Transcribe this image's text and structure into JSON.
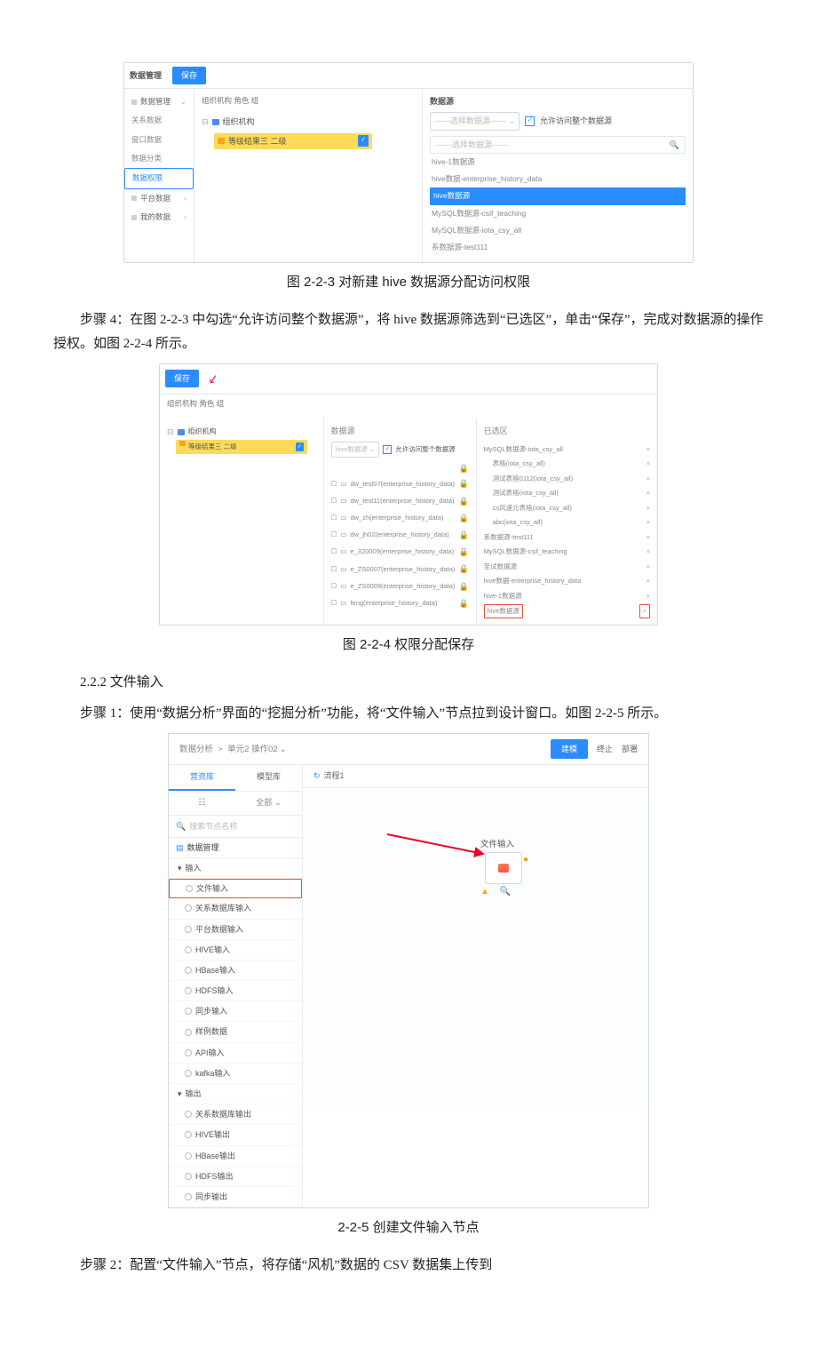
{
  "fig223": {
    "hdr_title": "数据管理",
    "hdr_save": "保存",
    "sidebar": {
      "items": [
        "数据管理",
        "关系数据",
        "窗口数据",
        "数据分类",
        "数据权限",
        "平台数据",
        "我的数据"
      ],
      "sel_index": 4
    },
    "crumb": "组织机构    角色    组",
    "tree_root": "组织机构",
    "tree_child": "等级结果三 二级",
    "right": {
      "title": "数据源",
      "picker": "------选择数据源------",
      "allow": "允许访问整个数据源",
      "search": "------选择数据源------",
      "items": [
        "hive-1数据源",
        "hive数据-enterprise_history_data",
        "hive数据源",
        "MySQL数据源-csif_teaching",
        "MySQL数据源-iota_csy_all",
        "系数据源-test111"
      ],
      "hl_index": 2
    },
    "caption": "图 2-2-3  对新建 hive 数据源分配访问权限"
  },
  "p1": "步骤 4：在图 2-2-3 中勾选“允许访问整个数据源”，将 hive 数据源筛选到“已选区”，单击“保存”，完成对数据源的操作授权。如图 2-2-4 所示。",
  "fig224": {
    "save": "保存",
    "crumb": "组织机构    角色    组",
    "tree_root": "组织机构",
    "tree_child": "等级结果三 二级",
    "mid": {
      "title": "数据源",
      "picker": "hive数据源",
      "allow": "允许访问整个数据源",
      "items": [
        "dw_test07(enterprise_history_data)",
        "dw_test11(enterprise_history_data)",
        "dw_zh(enterprise_history_data)",
        "dw_jh02(enterprise_history_data)",
        "e_320009(enterprise_history_data)",
        "e_ZS0007(enterprise_history_data)",
        "e_ZS0009(enterprise_history_data)",
        "feng(enterprise_history_data)"
      ]
    },
    "right": {
      "title": "已选区",
      "items": [
        "MySQL数据源-iota_csy_all",
        "表格(iota_csy_all)",
        "测试表格0112(iota_csy_all)",
        "测试表格(iota_csy_all)",
        "cs风速元表格(iota_csy_all)",
        "abc(iota_csy_all)",
        "系数据源-test111",
        "MySQL数据源-csif_teaching",
        "至试数据源",
        "hive数据-enterprise_history_data",
        "hive-1数据源",
        "hive数据源"
      ],
      "boxed_index": 11
    },
    "caption": "图 2-2-4  权限分配保存"
  },
  "subhead": "2.2.2 文件输入",
  "p2": "步骤 1：使用“数据分析”界面的“挖掘分析”功能，将“文件输入”节点拉到设计窗口。如图 2-2-5 所示。",
  "fig225": {
    "breadcrumb": {
      "a": "数据分析",
      "sep": ">",
      "b": "单元2 操作02"
    },
    "actions": {
      "run": "建模",
      "clear": "终止",
      "deploy": "部署"
    },
    "tabs": {
      "lib": "营资库",
      "model": "模型库"
    },
    "filter": "全部",
    "search": "搜索节点名称",
    "cat1": "数据管理",
    "group_in": "输入",
    "inputs": [
      "文件输入",
      "关系数据库输入",
      "平台数据输入",
      "HIVE输入",
      "HBase输入",
      "HDFS输入",
      "同步输入",
      "样例数据",
      "API输入",
      "kafka输入"
    ],
    "boxed_index": 0,
    "group_out": "输出",
    "outputs": [
      "关系数据库输出",
      "HIVE输出",
      "HBase输出",
      "HDFS输出",
      "同步输出"
    ],
    "flowtab": "流程1",
    "nodelabel": "文件输入",
    "caption": "2-2-5 创建文件输入节点"
  },
  "p3": "步骤 2：配置“文件输入”节点，将存储“风机”数据的 CSV 数据集上传到"
}
